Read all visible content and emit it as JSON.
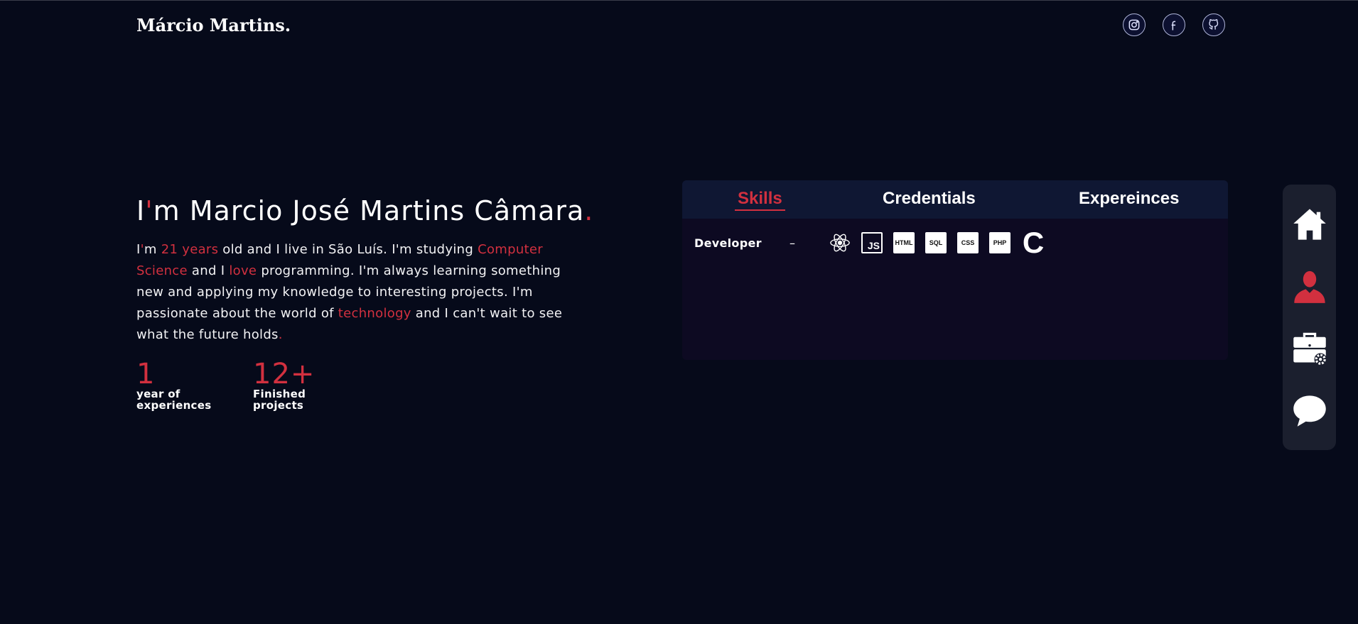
{
  "header": {
    "logo": "Márcio Martins.",
    "socials": [
      {
        "name": "instagram",
        "icon": "instagram-icon"
      },
      {
        "name": "facebook",
        "icon": "facebook-icon"
      },
      {
        "name": "github",
        "icon": "github-icon"
      }
    ]
  },
  "intro": {
    "title_first": "I",
    "title_apostrophe": "'",
    "title_main": "m Marcio José Martins Câmara",
    "title_dot": ".",
    "bio": {
      "p1": "I",
      "p2": "'",
      "p3": "m ",
      "p4": "21 years",
      "p5": " old and I live in São Luís. I'm studying ",
      "p6": "Computer Science",
      "p7": " and I ",
      "p8": "love",
      "p9": " programming. I'm always learning something new and applying my knowledge to interesting projects. I'm passionate about the world of ",
      "p10": "technology",
      "p11": " and I can't wait to see what the future holds",
      "p12": "."
    }
  },
  "stats": [
    {
      "value": "1",
      "label_line1": "year of",
      "label_line2": "experiences"
    },
    {
      "value": "12+",
      "label_line1": "Finished",
      "label_line2": "projects"
    }
  ],
  "card": {
    "tabs": {
      "skills": "Skills",
      "credentials": "Credentials",
      "experiences": "Expereinces"
    },
    "active_tab": "Skills",
    "skills": [
      {
        "name": "Developer",
        "separator": "–",
        "icons": {
          "react": "react-icon",
          "js": "JS",
          "html": "HTML",
          "sql": "SQL",
          "css": "CSS",
          "php": "PHP",
          "c": "C"
        }
      }
    ]
  },
  "sidenav": {
    "items": [
      "home-icon",
      "user-icon",
      "briefcase-icon",
      "chat-icon"
    ]
  },
  "colors": {
    "background": "#060a1a",
    "accent": "#d2303f",
    "card": "#0d0a22",
    "tabbar": "#0f1733",
    "sidenav": "#1b1f2e"
  }
}
